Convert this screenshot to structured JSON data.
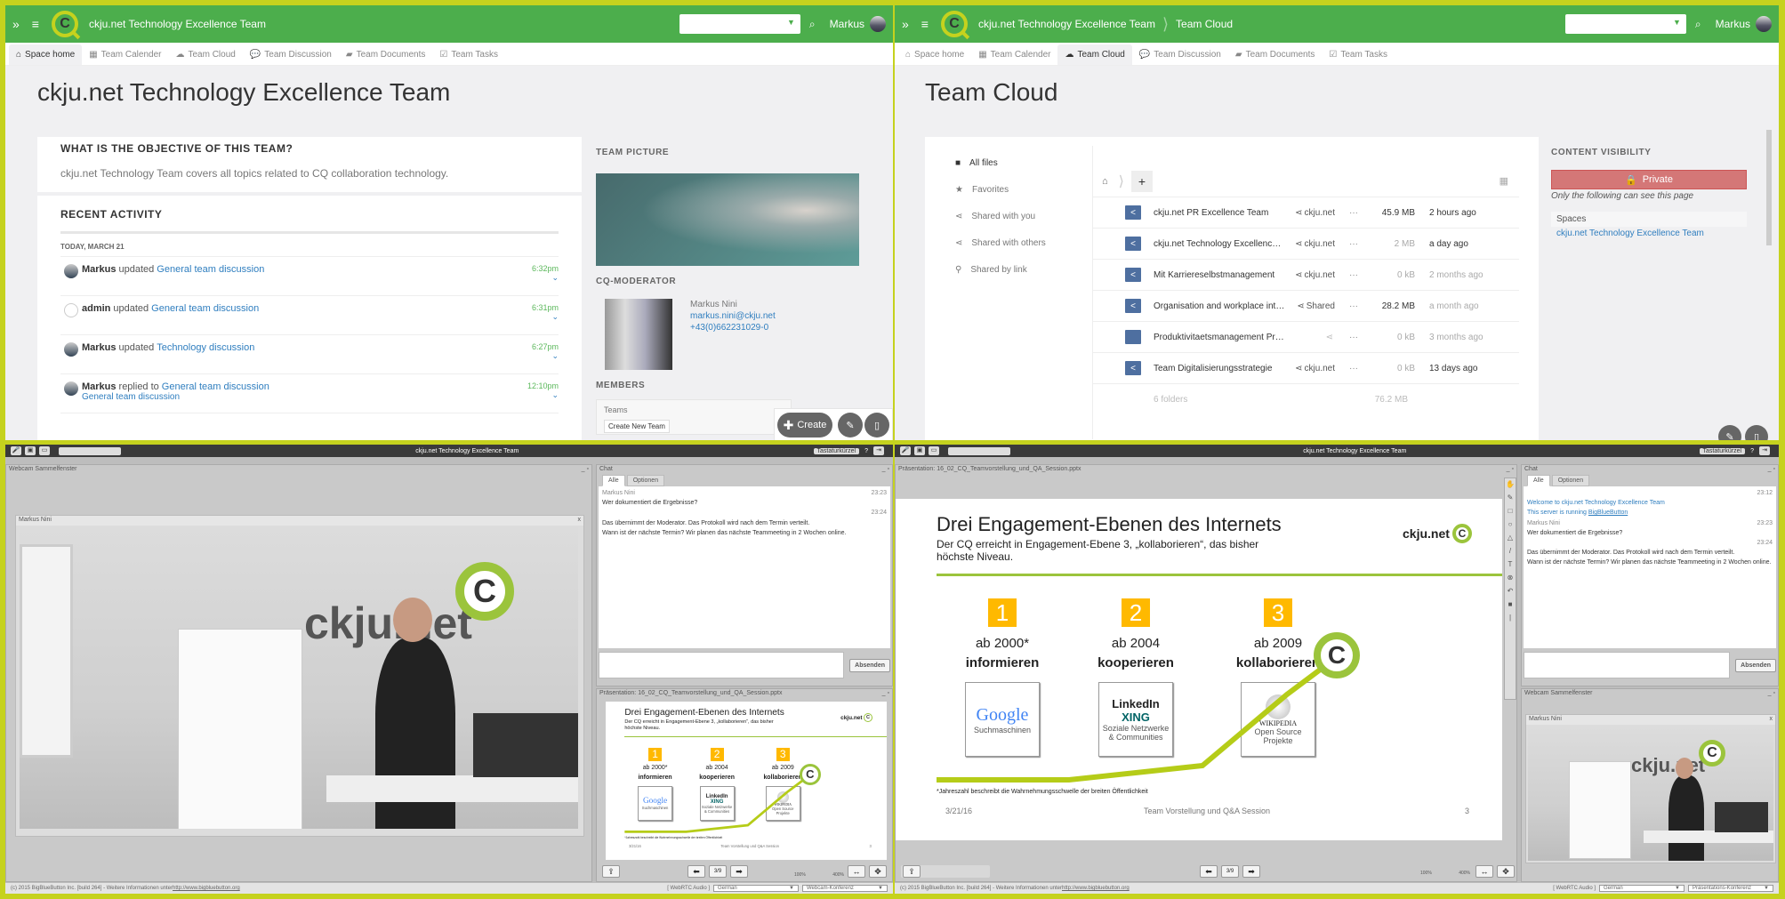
{
  "space_home": {
    "header": {
      "title": "ckju.net Technology Excellence Team",
      "user": "Markus"
    },
    "tabs": [
      {
        "label": "Space home",
        "icon": "home-icon",
        "active": true
      },
      {
        "label": "Team Calender",
        "icon": "calendar-icon"
      },
      {
        "label": "Team Cloud",
        "icon": "cloud-icon"
      },
      {
        "label": "Team Discussion",
        "icon": "comments-icon"
      },
      {
        "label": "Team Documents",
        "icon": "folder-icon"
      },
      {
        "label": "Team Tasks",
        "icon": "checkbox-icon"
      }
    ],
    "page_title": "ckju.net Technology Excellence Team",
    "objective": {
      "heading": "WHAT IS THE OBJECTIVE OF THIS TEAM?",
      "text": "ckju.net Technology Team covers all topics related to CQ collaboration technology."
    },
    "recent_activity": {
      "heading": "RECENT ACTIVITY",
      "date": "TODAY, MARCH 21",
      "items": [
        {
          "user": "Markus",
          "verb": "updated",
          "target": "General team discussion",
          "sub": "",
          "time": "6:32pm"
        },
        {
          "user": "admin",
          "verb": "updated",
          "target": "General team discussion",
          "sub": "",
          "time": "6:31pm"
        },
        {
          "user": "Markus",
          "verb": "updated",
          "target": "Technology discussion",
          "sub": "",
          "time": "6:27pm"
        },
        {
          "user": "Markus",
          "verb": "replied to",
          "target": "General team discussion",
          "sub": "General team discussion",
          "time": "12:10pm"
        }
      ]
    },
    "sidebar": {
      "team_picture": "TEAM PICTURE",
      "moderator_heading": "CQ-MODERATOR",
      "moderator": {
        "name": "Markus Nini",
        "email": "markus.nini@ckju.net",
        "phone": "+43(0)662231029-0"
      },
      "members_heading": "MEMBERS",
      "teams_label": "Teams",
      "create_team": "Create New Team"
    },
    "fab": {
      "create": "Create"
    }
  },
  "team_cloud": {
    "header": {
      "title": "ckju.net Technology Excellence Team",
      "crumb": "Team Cloud",
      "user": "Markus"
    },
    "page_title": "Team Cloud",
    "nav": [
      "All files",
      "Favorites",
      "Shared with you",
      "Shared with others",
      "Shared by link"
    ],
    "files": [
      {
        "name": "ckju.net PR Excellence Team",
        "share": "ckju.net",
        "size": "45.9 MB",
        "modified": "2 hours ago",
        "shared_folder": true
      },
      {
        "name": "ckju.net Technology Excellence Team",
        "share": "ckju.net",
        "size": "2 MB",
        "modified": "a day ago",
        "shared_folder": true
      },
      {
        "name": "Mit Karriereselbstmanagement",
        "share": "ckju.net",
        "size": "0 kB",
        "modified": "2 months ago",
        "shared_folder": true
      },
      {
        "name": "Organisation and workplace interventi...",
        "share": "Shared",
        "size": "28.2 MB",
        "modified": "a month ago",
        "shared_folder": true
      },
      {
        "name": "Produktivitaetsmanagement Produktion",
        "share": "",
        "size": "0 kB",
        "modified": "3 months ago",
        "shared_folder": false
      },
      {
        "name": "Team Digitalisierungsstrategie",
        "share": "ckju.net",
        "size": "0 kB",
        "modified": "13 days ago",
        "shared_folder": true
      }
    ],
    "summary": {
      "folders": "6 folders",
      "total": "76.2 MB"
    },
    "visibility": {
      "heading": "CONTENT VISIBILITY",
      "badge": "Private",
      "note": "Only the following can see this page",
      "spaces_label": "Spaces",
      "space": "ckju.net Technology Excellence Team"
    }
  },
  "bbb": {
    "title": "ckju.net Technology Excellence Team",
    "shortcuts": "Tastaturkürzel",
    "webcam_window": "Webcam Sammelfenster",
    "webcam_user": "Markus Nini",
    "chat": {
      "title": "Chat",
      "tabs": [
        "Alle",
        "Optionen"
      ],
      "welcome": "Welcome to ckju.net Technology Excellence Team",
      "server_prefix": "This server is running ",
      "server_link": "BigBlueButton",
      "welcome_time": "23:12",
      "sender": "Markus Nini",
      "t1": "23:23",
      "m1": "Wer dokumentiert die Ergebnisse?",
      "t2": "23:24",
      "m2": "Das übernimmt der Moderator. Das Protokoll wird nach dem Termin verteilt.",
      "m3": "Wann ist der nächste Termin? Wir planen das nächste Teammeeting in 2 Wochen online.",
      "send": "Absenden"
    },
    "presentation": {
      "title": "Präsentation: 16_02_CQ_Teamvorstellung_und_QA_Session.pptx",
      "page": "3/9",
      "zoom_min": "100%",
      "zoom_max": "400%"
    },
    "slide": {
      "title": "Drei Engagement-Ebenen des Internets",
      "subtitle": "Der CQ erreicht in Engagement-Ebene 3, „kollaborieren“, das bisher höchste Niveau.",
      "brand": "ckju.net",
      "levels": [
        {
          "num": "1",
          "year": "ab 2000*",
          "verb": "informieren",
          "logo": "Google",
          "caption": "Suchmaschinen"
        },
        {
          "num": "2",
          "year": "ab 2004",
          "verb": "kooperieren",
          "logo": "LinkedIn / XING",
          "caption": "Soziale Netzwerke & Communities"
        },
        {
          "num": "3",
          "year": "ab 2009",
          "verb": "kollaborieren",
          "logo": "Wikipedia",
          "caption": "Open Source Projekte"
        }
      ],
      "footnote": "*Jahreszahl beschreibt die Wahrnehmungsschwelle der breiten Öffentlichkeit",
      "date": "3/21/16",
      "footer": "Team Vorstellung und Q&A Session",
      "number": "3"
    },
    "footer": {
      "copyright": "(c) 2015 BigBlueButton Inc. [build 264] - Weitere Informationen unter ",
      "link": "http://www.bigbluebutton.org",
      "audio": "[ WebRTC Audio ]",
      "language": "German",
      "layout_left": "Webcam-Konferenz",
      "layout_right": "Präsentations-Konferenz"
    }
  }
}
